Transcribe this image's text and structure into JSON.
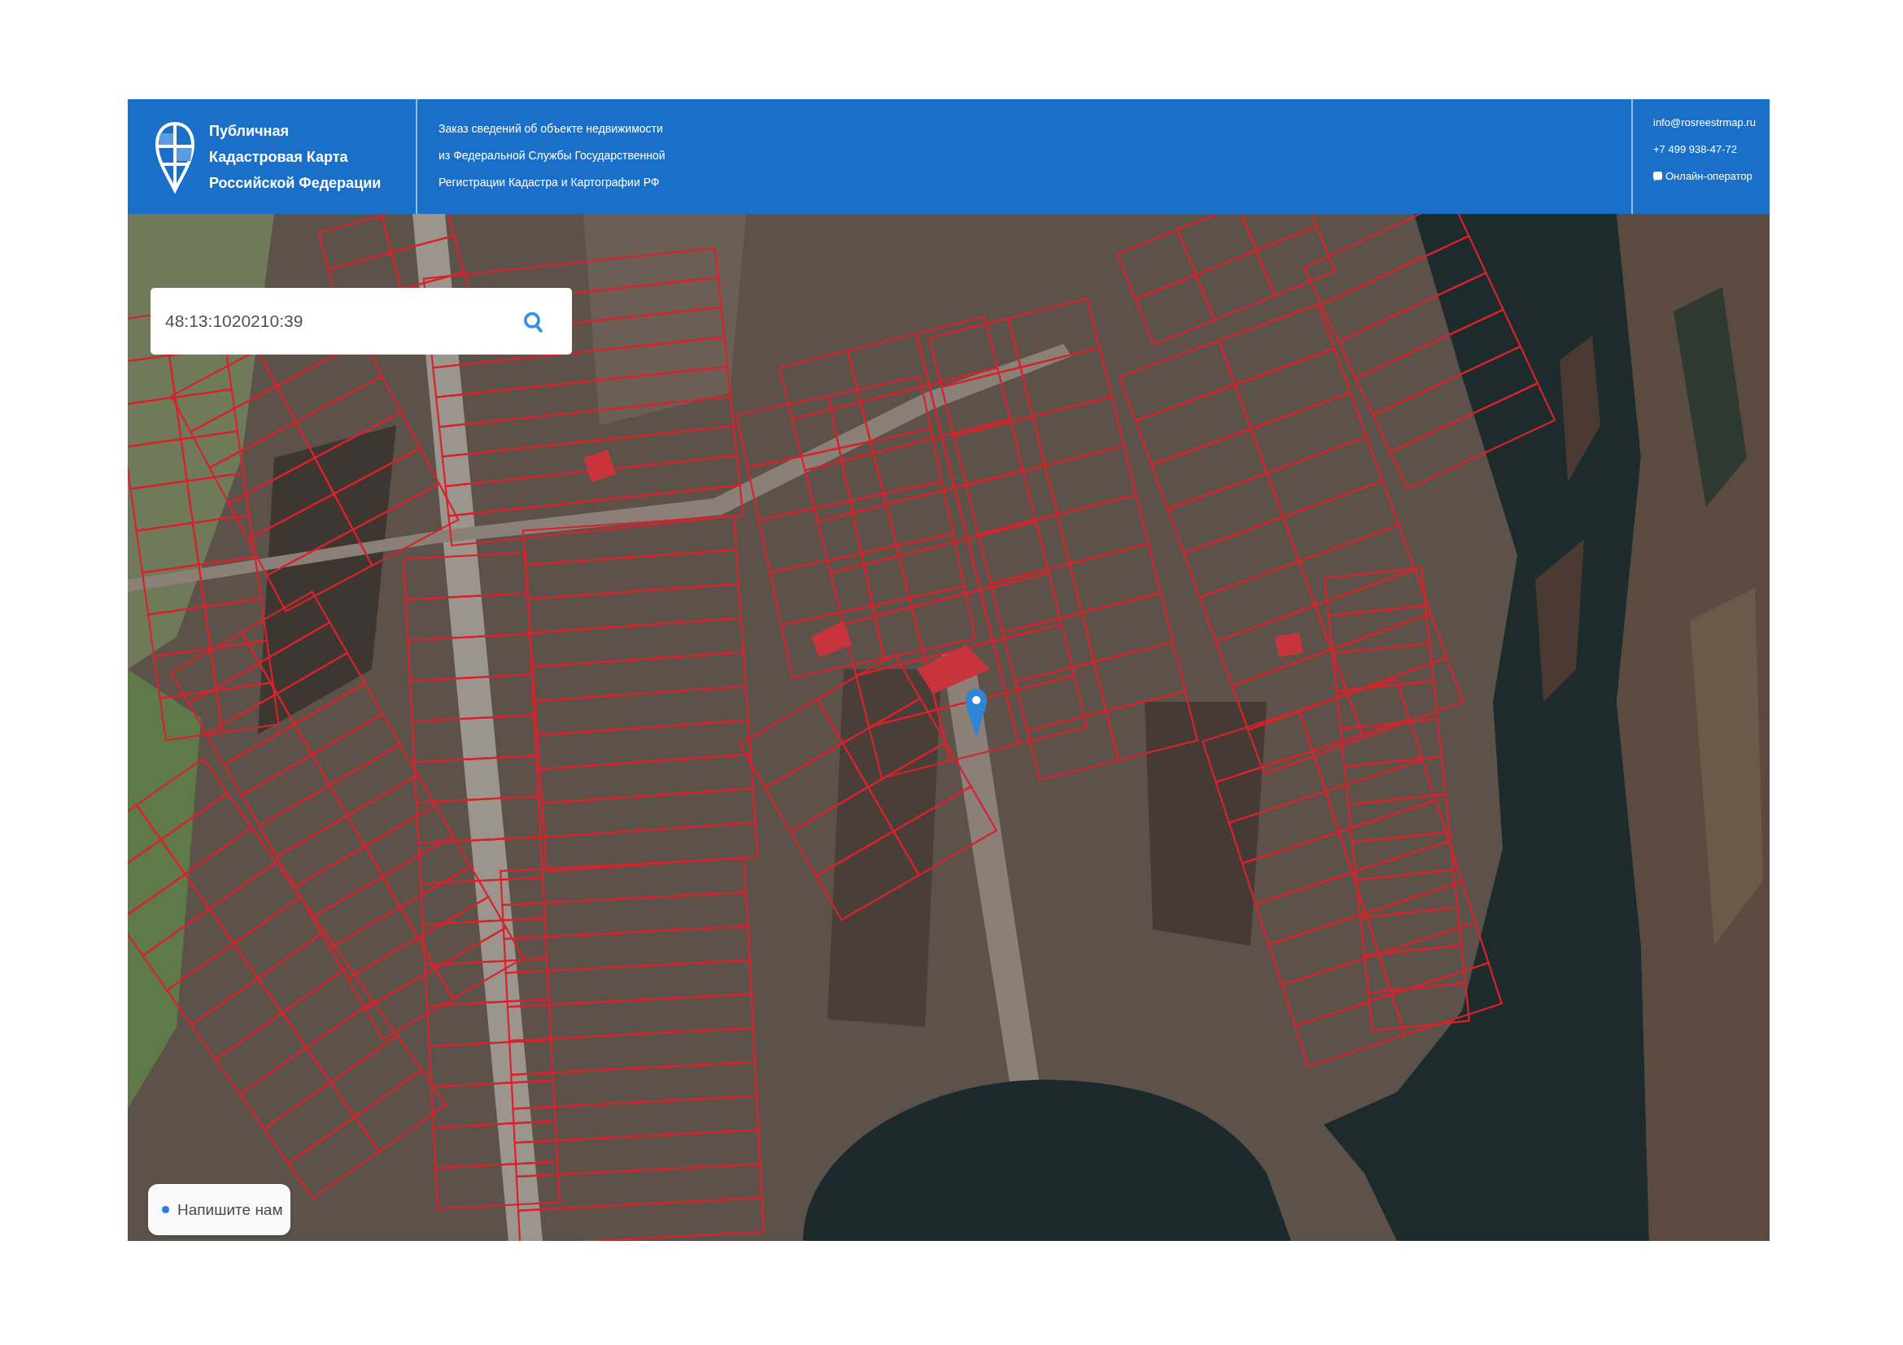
{
  "header": {
    "title_lines": [
      "Публичная",
      "Кадастровая Карта",
      "Российской Федерации"
    ],
    "description_lines": [
      "Заказ сведений об объекте недвижимости",
      "из Федеральной Службы Государственной",
      "Регистрации Кадастра и Картографии РФ"
    ],
    "contacts": {
      "email": "info@rosreestrmap.ru",
      "phone": "+7 499 938-47-72",
      "chat_link": "Онлайн-оператор"
    }
  },
  "map": {
    "search": {
      "value": "48:13:1020210:39"
    },
    "chat_button": "Напишите нам"
  }
}
